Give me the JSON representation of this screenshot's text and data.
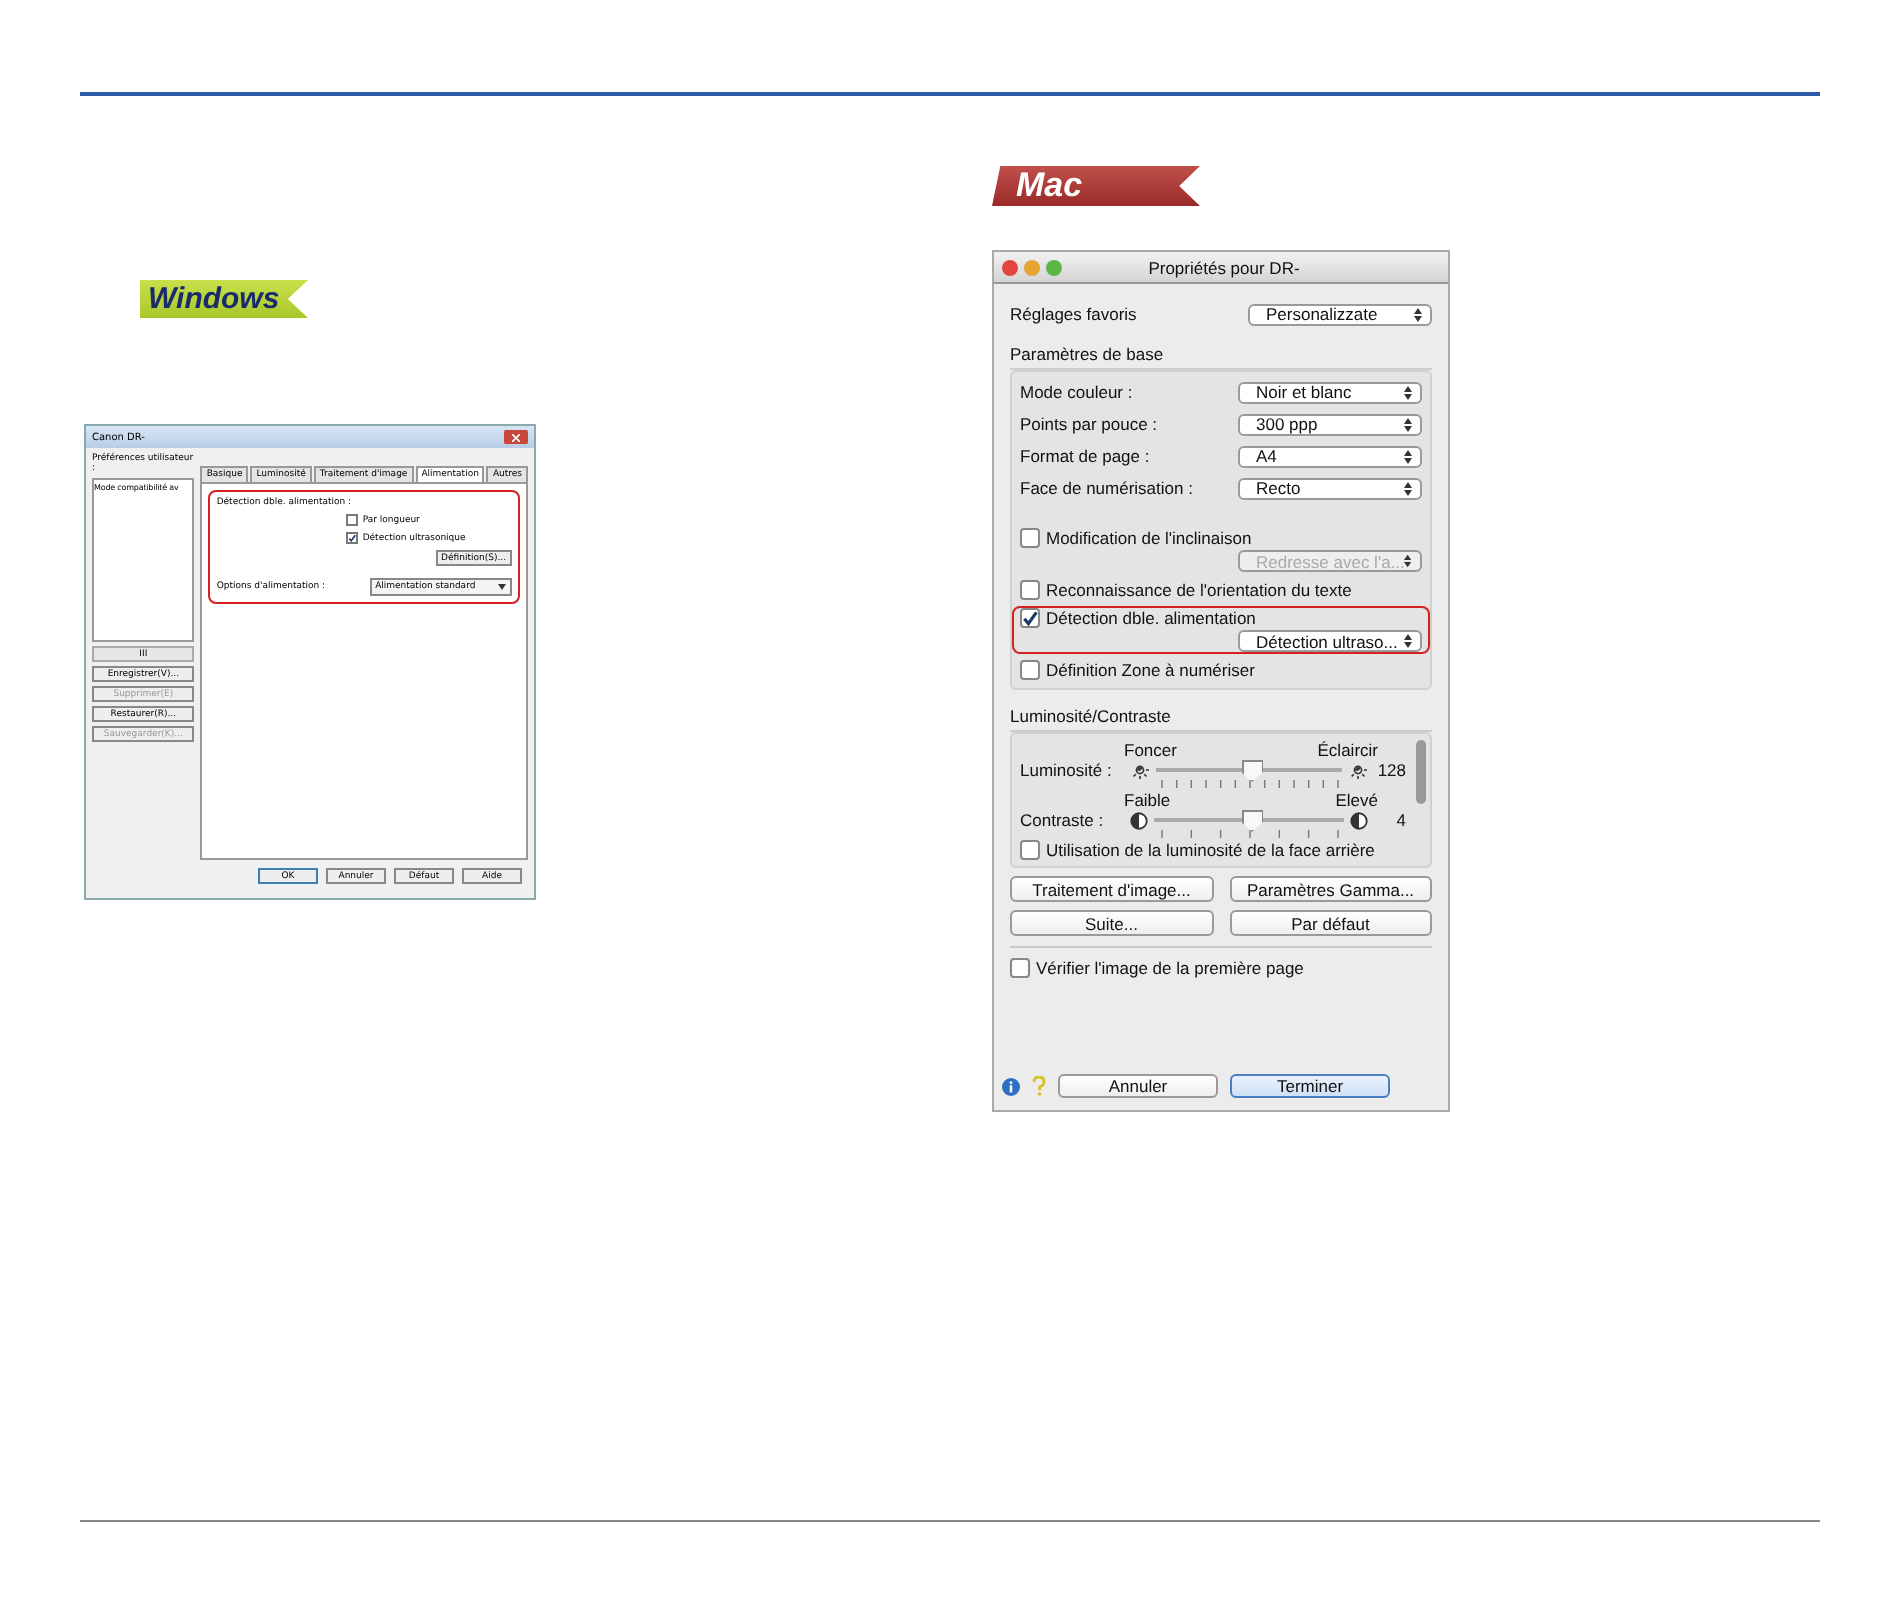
{
  "windows": {
    "badge": "Windows",
    "dialog": {
      "title": "Canon DR-",
      "prefs_label": "Préférences utilisateur :",
      "list_items": [
        {
          "label": "Mode compatibilité av",
          "selected": false
        }
      ],
      "scroll_mark": "III",
      "side_buttons": [
        {
          "label": "Enregistrer(V)...",
          "disabled": false
        },
        {
          "label": "Supprimer(E)",
          "disabled": true
        },
        {
          "label": "Restaurer(R)...",
          "disabled": false
        },
        {
          "label": "Sauvegarder(K)...",
          "disabled": true
        }
      ],
      "tabs": [
        {
          "label": "Basique",
          "selected": false
        },
        {
          "label": "Luminosité",
          "selected": false
        },
        {
          "label": "Traitement d'image",
          "selected": false
        },
        {
          "label": "Alimentation",
          "selected": true
        },
        {
          "label": "Autres",
          "selected": false
        }
      ],
      "group": {
        "highlighted": true,
        "title": "Détection dble. alimentation :",
        "checks": [
          {
            "label": "Par longueur",
            "checked": false
          },
          {
            "label": "Détection ultrasonique",
            "checked": true
          }
        ],
        "settings_button": "Définition(S)...",
        "feed_label": "Options d'alimentation :",
        "feed_value": "Alimentation standard"
      },
      "buttons": [
        "OK",
        "Annuler",
        "Défaut",
        "Aide"
      ]
    }
  },
  "mac": {
    "badge": "Mac",
    "window": {
      "title": "Propriétés pour DR-",
      "favorites": {
        "label": "Réglages favoris",
        "value": "Personalizzate"
      },
      "basic": {
        "title": "Paramètres de base",
        "selects": [
          {
            "label": "Mode couleur :",
            "value": "Noir et blanc"
          },
          {
            "label": "Points par pouce :",
            "value": "300 ppp"
          },
          {
            "label": "Format de page :",
            "value": "A4"
          },
          {
            "label": "Face de numérisation :",
            "value": "Recto"
          }
        ],
        "options": [
          {
            "label": "Modification de l'inclinaison",
            "checked": false,
            "highlighted": false,
            "select": {
              "value": "Redresse avec l'a...",
              "disabled": true
            }
          },
          {
            "label": "Reconnaissance de l'orientation du texte",
            "checked": false,
            "highlighted": false
          },
          {
            "label": "Détection dble. alimentation",
            "checked": true,
            "highlighted": true,
            "select": {
              "value": "Détection ultraso...",
              "disabled": false
            }
          },
          {
            "label": "Définition Zone à numériser",
            "checked": false,
            "highlighted": false
          }
        ]
      },
      "brightness": {
        "title": "Luminosité/Contraste",
        "sliders": [
          {
            "kind": "sun",
            "label": "Luminosité :",
            "low": "Foncer",
            "high": "Éclaircir",
            "level": 0.5,
            "reading": "128"
          },
          {
            "kind": "contrast",
            "label": "Contraste :",
            "low": "Faible",
            "high": "Elevé",
            "level": 0.5,
            "reading": "4"
          }
        ],
        "back_option": {
          "label": "Utilisation de la luminosité de la face arrière",
          "checked": false
        }
      },
      "buttons": [
        "Traitement d'image...",
        "Paramètres Gamma...",
        "Suite...",
        "Par défaut"
      ],
      "verify": {
        "label": "Vérifier l'image de la première page",
        "checked": false
      },
      "footer_buttons": [
        {
          "label": "Annuler",
          "default": false
        },
        {
          "label": "Terminer",
          "default": true
        }
      ]
    }
  }
}
